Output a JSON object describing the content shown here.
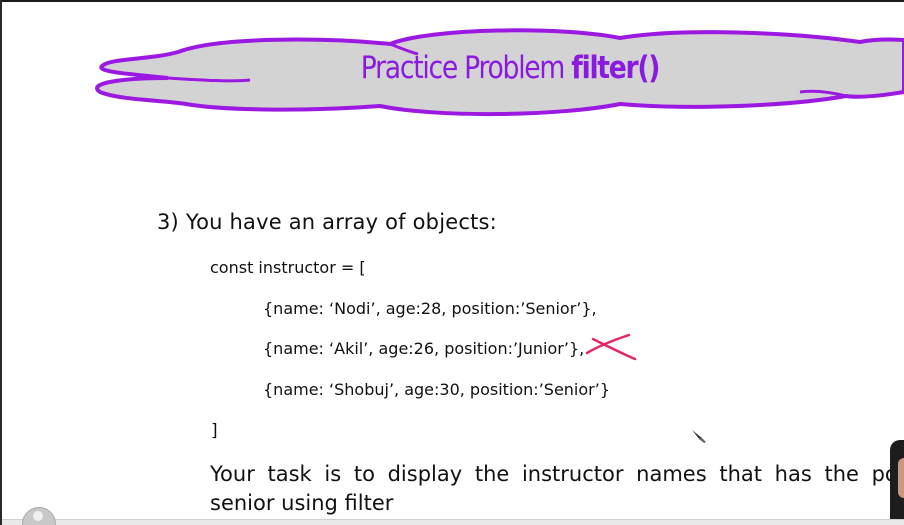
{
  "title": {
    "prefix": "Practice Problem ",
    "keyword": "filter()"
  },
  "question": "3) You have an array of objects:",
  "code": [
    "const instructor = [",
    "{name: ‘Nodi’, age:28, position:’Senior’},",
    "{name: ‘Akil’, age:26, position:’Junior’},",
    "{name: ‘Shobuj’, age:30, position:’Senior’}",
    "]"
  ],
  "task": {
    "line1": "Your task is to display the instructor names that has the po",
    "line2": "senior using filter"
  },
  "colors": {
    "title": "#8a1ae0",
    "cloud_fill": "#d3d3d3",
    "cloud_stroke": "#9b19e0",
    "cross": "#e8246a"
  },
  "icons": [
    "cloud-banner",
    "cross-mark-icon",
    "pen-cursor-icon",
    "presenter-avatar-icon"
  ]
}
